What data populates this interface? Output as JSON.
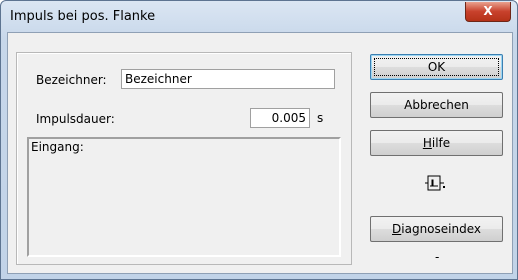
{
  "window": {
    "title": "Impuls bei pos. Flanke",
    "close_symbol": "X"
  },
  "form": {
    "name_label": "Bezeichner:",
    "name_value": "Bezeichner",
    "duration_label": "Impulsdauer:",
    "duration_value": "0.005",
    "duration_unit": "s",
    "input_label": "Eingang:"
  },
  "buttons": {
    "ok": "OK",
    "cancel": "Abbrechen",
    "help_mnemonic": "H",
    "help_rest": "ilfe",
    "diag_mnemonic": "D",
    "diag_rest": "iagnoseindex"
  },
  "diagnose_index_value": "-",
  "icons": {
    "pulse_icon": "pulse-block-icon"
  }
}
